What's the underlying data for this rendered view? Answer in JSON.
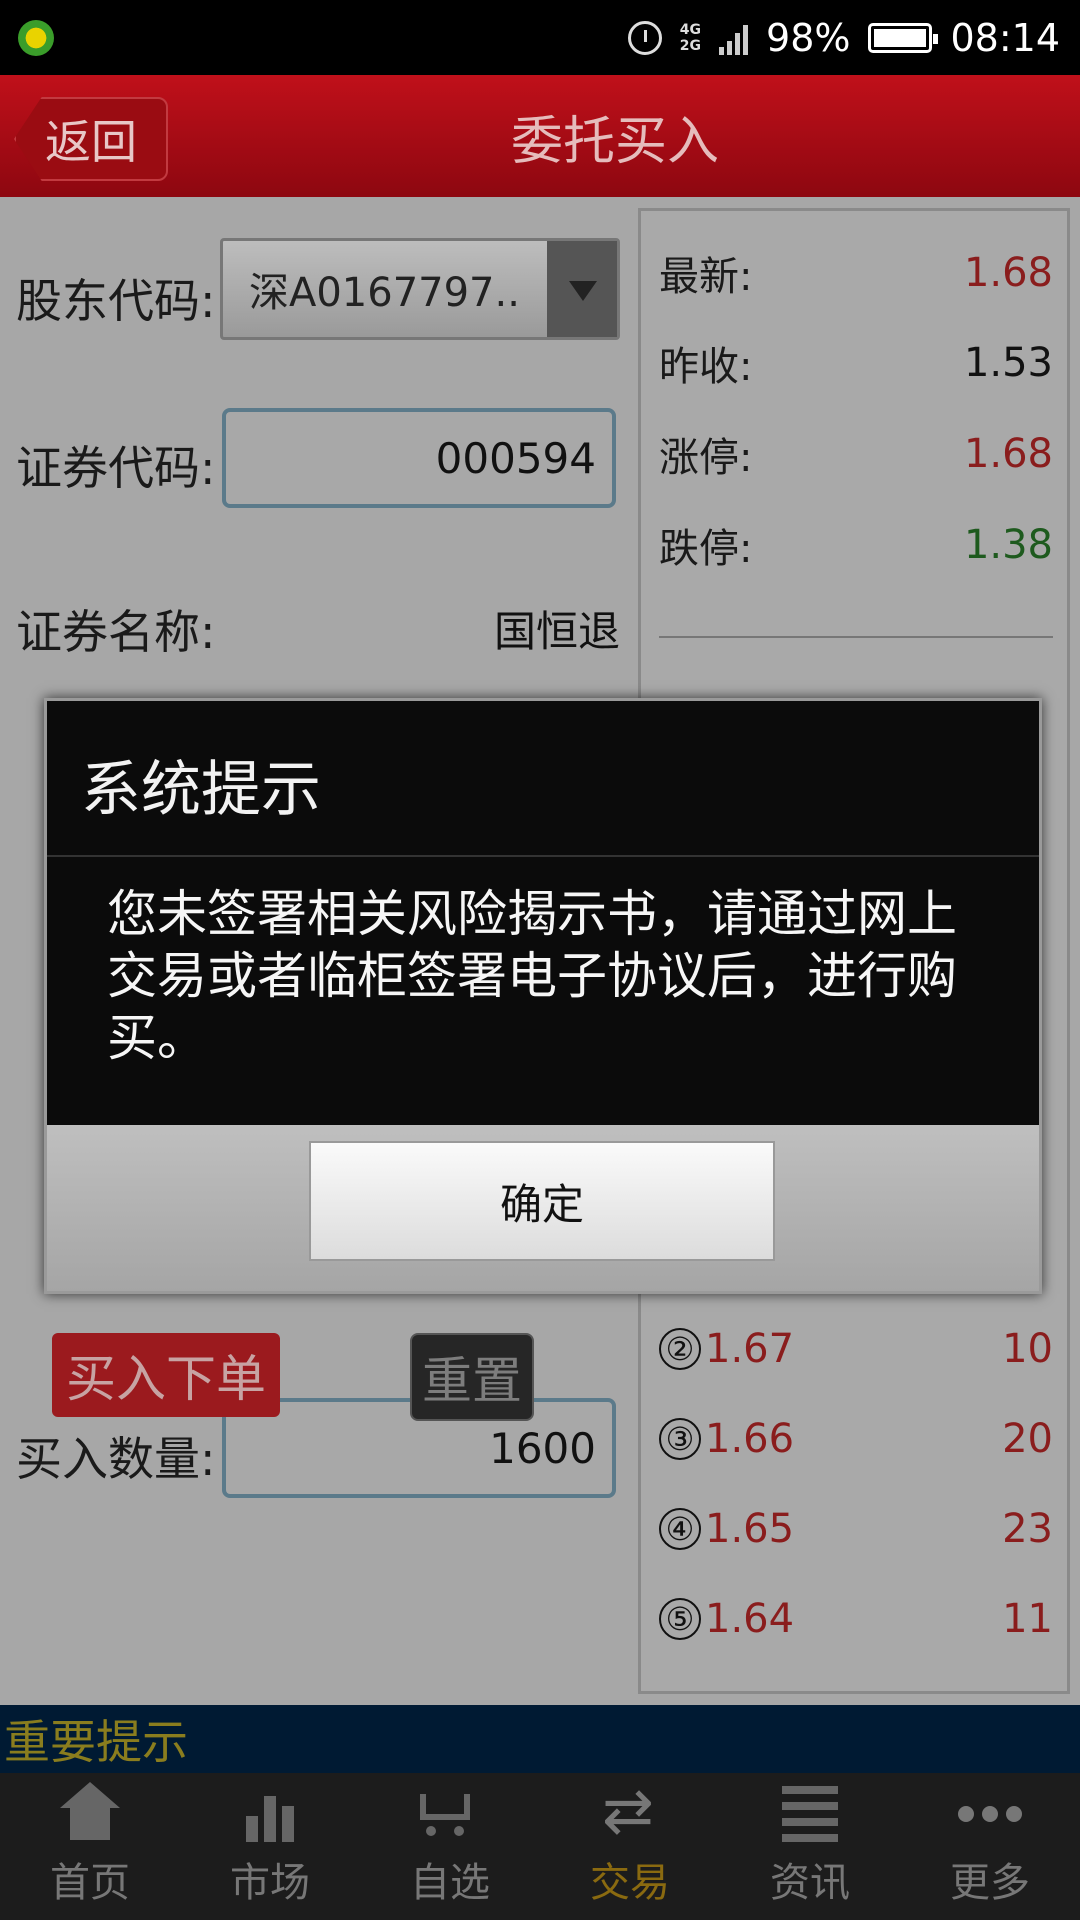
{
  "status": {
    "network": [
      "4G",
      "2G"
    ],
    "battery": "98%",
    "time": "08:14"
  },
  "header": {
    "back_label": "返回",
    "title": "委托买入"
  },
  "form": {
    "holder_label": "股东代码:",
    "holder_value": "深A0167797..",
    "code_label": "证券代码:",
    "code_value": "000594",
    "name_label": "证券名称:",
    "name_value": "国恒退",
    "quantity_label": "买入数量:",
    "quantity_value": "1600",
    "buy_button": "买入下单",
    "reset_button": "重置"
  },
  "quote": {
    "latest_label": "最新:",
    "latest_value": "1.68",
    "prev_close_label": "昨收:",
    "prev_close_value": "1.53",
    "limit_up_label": "涨停:",
    "limit_up_value": "1.68",
    "limit_down_label": "跌停:",
    "limit_down_value": "1.38",
    "bids": [
      {
        "index": "②",
        "price": "1.67",
        "volume": "10"
      },
      {
        "index": "③",
        "price": "1.66",
        "volume": "20"
      },
      {
        "index": "④",
        "price": "1.65",
        "volume": "23"
      },
      {
        "index": "⑤",
        "price": "1.64",
        "volume": "11"
      }
    ]
  },
  "notice": "重要提示",
  "nav": {
    "items": [
      {
        "label": "首页",
        "icon": "home-icon"
      },
      {
        "label": "市场",
        "icon": "bar-chart-icon"
      },
      {
        "label": "自选",
        "icon": "cart-icon"
      },
      {
        "label": "交易",
        "icon": "swap-icon"
      },
      {
        "label": "资讯",
        "icon": "news-icon"
      },
      {
        "label": "更多",
        "icon": "more-icon"
      }
    ],
    "active": "交易"
  },
  "dialog": {
    "title": "系统提示",
    "message": "您未签署相关风险揭示书，请通过网上交易或者临柜签署电子协议后，进行购买。",
    "ok_label": "确定"
  },
  "colors": {
    "header_red": "#b50f17",
    "price_red": "#8a1d1d",
    "price_green": "#1e5a1e",
    "active_nav": "#8a6a10"
  }
}
